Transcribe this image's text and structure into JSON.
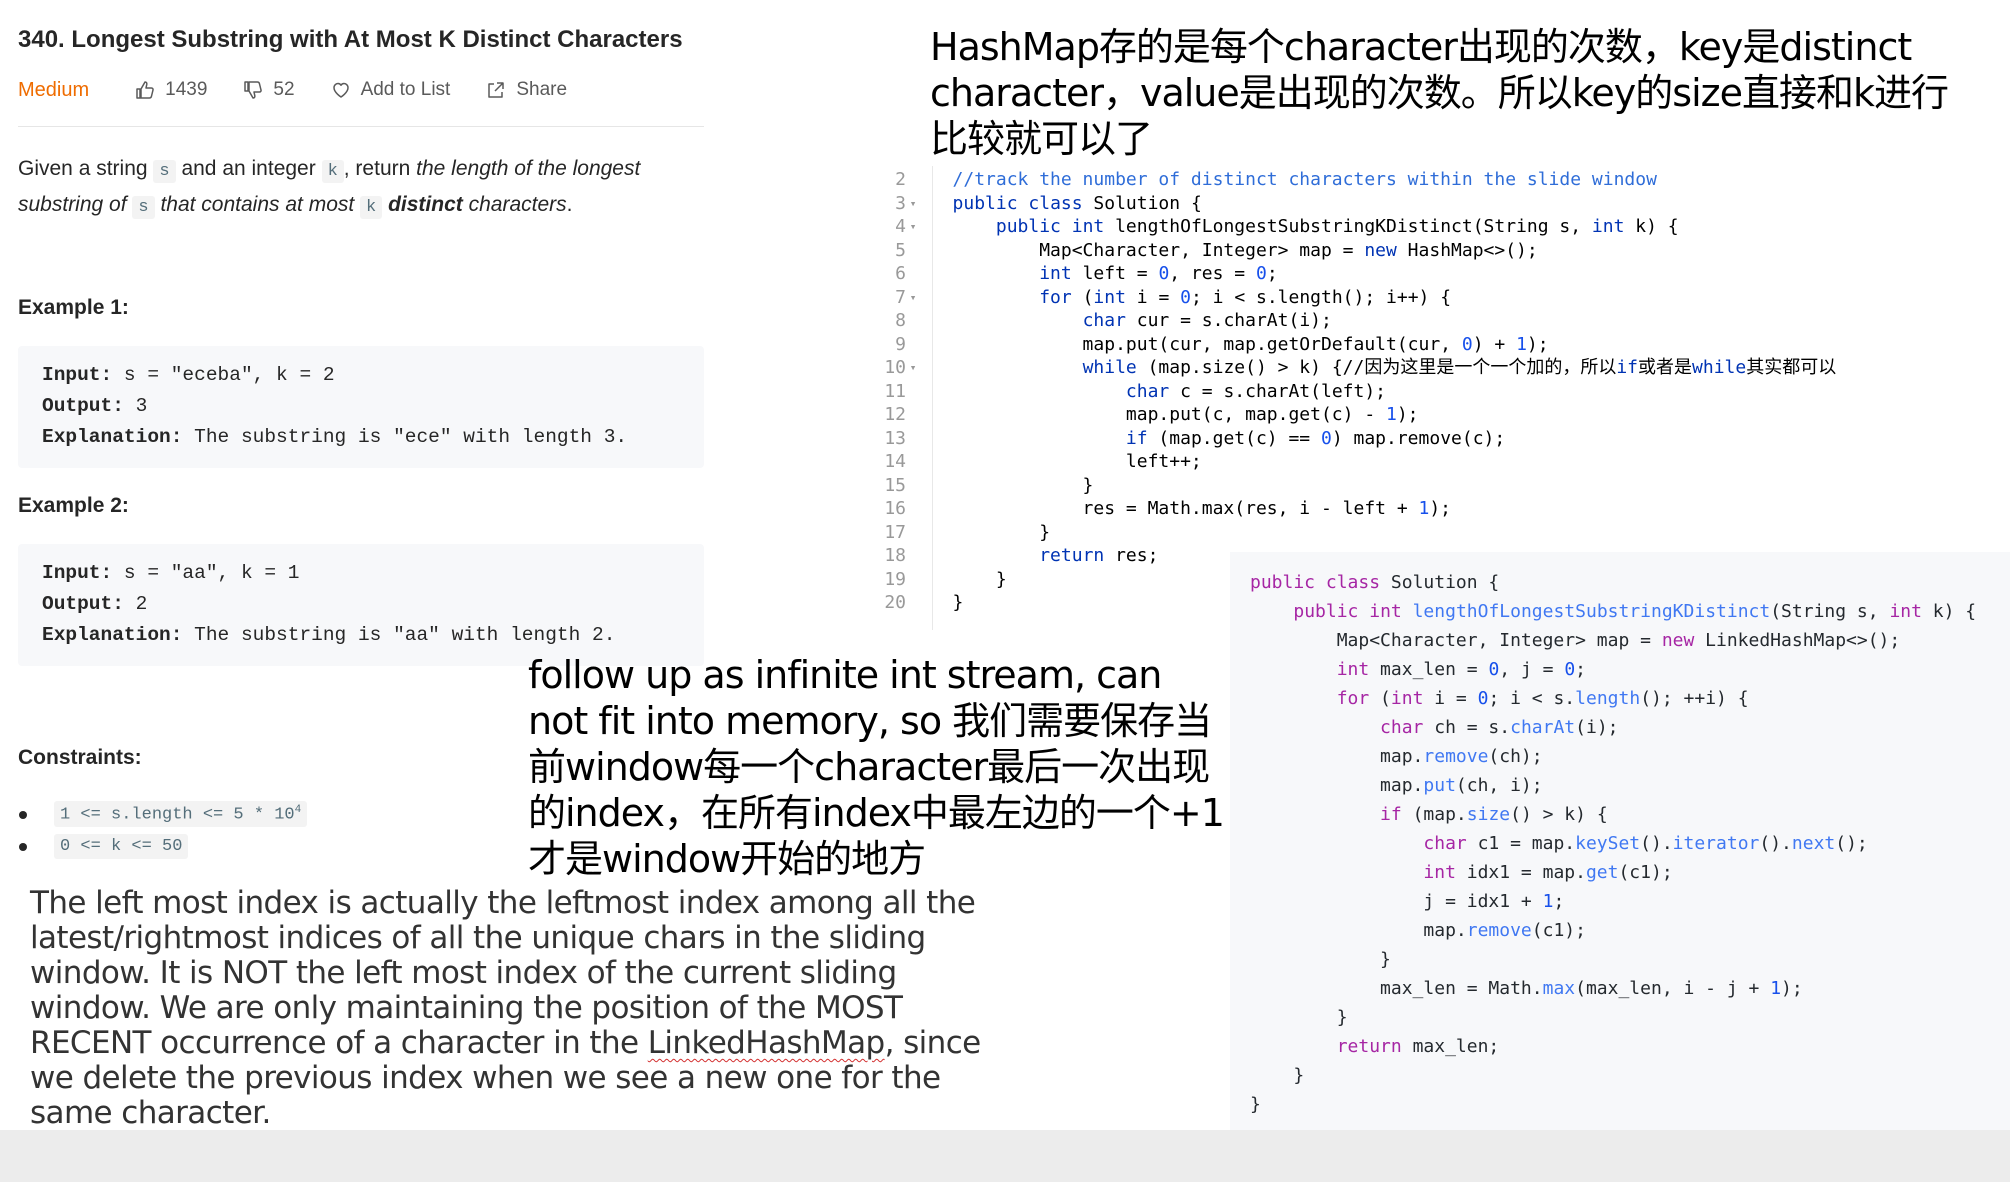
{
  "problem": {
    "title": "340. Longest Substring with At Most K Distinct Characters",
    "difficulty": "Medium",
    "likes": "1439",
    "dislikes": "52",
    "add_to_list": "Add to List",
    "share": "Share",
    "desc_parts": [
      "Given a string ",
      "s",
      " and an integer ",
      "k",
      ", return ",
      "the length of the longest substring of ",
      "s",
      " that contains at most ",
      "k",
      " ",
      "distinct",
      " characters",
      "."
    ],
    "example1_heading": "Example 1:",
    "example1": {
      "input_label": "Input:",
      "input": " s = \"eceba\", k = 2",
      "output_label": "Output:",
      "output": " 3",
      "explanation_label": "Explanation:",
      "explanation": " The substring is \"ece\" with length 3."
    },
    "example2_heading": "Example 2:",
    "example2": {
      "input_label": "Input:",
      "input": " s = \"aa\", k = 1",
      "output_label": "Output:",
      "output": " 2",
      "explanation_label": "Explanation:",
      "explanation": " The substring is \"aa\" with length 2."
    },
    "constraints_heading": "Constraints:",
    "constraints": [
      {
        "text": "1 <= s.length <= 5 * 10",
        "sup": "4"
      },
      {
        "text": "0 <= k <= 50",
        "sup": ""
      }
    ]
  },
  "notes": {
    "top": "HashMap存的是每个character出现的次数，key是distinct character，value是出现的次数。所以key的size直接和k进行比较就可以了",
    "middle": "follow up as infinite int stream, can not fit into memory, so 我们需要保存当前window每一个character最后一次出现的index，在所有index中最左边的一个+1才是window开始的地方",
    "english_before": "The left most index is actually the leftmost index among all the latest/rightmost indices of all the unique chars in the sliding window. It is NOT the left most index of the current sliding window. We are only maintaining the position of the MOST RECENT occurrence of a character in the ",
    "english_link": "LinkedHashMap",
    "english_after": ", since we delete the previous index when we see a new one for the same character."
  },
  "code1": {
    "lines": [
      {
        "n": "2",
        "fold": "",
        "text": "   //track the number of distinct characters within the slide window"
      },
      {
        "n": "3",
        "fold": "▾",
        "text": "   public class Solution {"
      },
      {
        "n": "4",
        "fold": "▾",
        "text": "       public int lengthOfLongestSubstringKDistinct(String s, int k) {"
      },
      {
        "n": "5",
        "fold": "",
        "text": "           Map<Character, Integer> map = new HashMap<>();"
      },
      {
        "n": "6",
        "fold": "",
        "text": "           int left = 0, res = 0;"
      },
      {
        "n": "7",
        "fold": "▾",
        "text": "           for (int i = 0; i < s.length(); i++) {"
      },
      {
        "n": "8",
        "fold": "",
        "text": "               char cur = s.charAt(i);"
      },
      {
        "n": "9",
        "fold": "",
        "text": "               map.put(cur, map.getOrDefault(cur, 0) + 1);"
      },
      {
        "n": "10",
        "fold": "▾",
        "text": "               while (map.size() > k) {//因为这里是一个一个加的，所以if或者是while其实都可以"
      },
      {
        "n": "11",
        "fold": "",
        "text": "                   char c = s.charAt(left);"
      },
      {
        "n": "12",
        "fold": "",
        "text": "                   map.put(c, map.get(c) - 1);"
      },
      {
        "n": "13",
        "fold": "",
        "text": "                   if (map.get(c) == 0) map.remove(c);"
      },
      {
        "n": "14",
        "fold": "",
        "text": "                   left++;"
      },
      {
        "n": "15",
        "fold": "",
        "text": "               }"
      },
      {
        "n": "16",
        "fold": "",
        "text": "               res = Math.max(res, i - left + 1);"
      },
      {
        "n": "17",
        "fold": "",
        "text": "           }"
      },
      {
        "n": "18",
        "fold": "",
        "text": "           return res;"
      },
      {
        "n": "19",
        "fold": "",
        "text": "       }"
      },
      {
        "n": "20",
        "fold": "",
        "text": "   }"
      }
    ]
  },
  "code2": {
    "lines": [
      "public class Solution {",
      "    public int lengthOfLongestSubstringKDistinct(String s, int k) {",
      "        Map<Character, Integer> map = new LinkedHashMap<>();",
      "        int max_len = 0, j = 0;",
      "        for (int i = 0; i < s.length(); ++i) {",
      "            char ch = s.charAt(i);",
      "            map.remove(ch);",
      "            map.put(ch, i);",
      "            if (map.size() > k) {",
      "                char c1 = map.keySet().iterator().next();",
      "                int idx1 = map.get(c1);",
      "                j = idx1 + 1;",
      "                map.remove(c1);",
      "            }",
      "            max_len = Math.max(max_len, i - j + 1);",
      "        }",
      "        return max_len;",
      "    }",
      "}"
    ]
  },
  "colors": {
    "difficulty": "#ef6c00",
    "keyword": "#0033b3",
    "comment": "#2f6dd8",
    "code2_keyword": "#a626a4",
    "code2_function": "#4078f2"
  }
}
